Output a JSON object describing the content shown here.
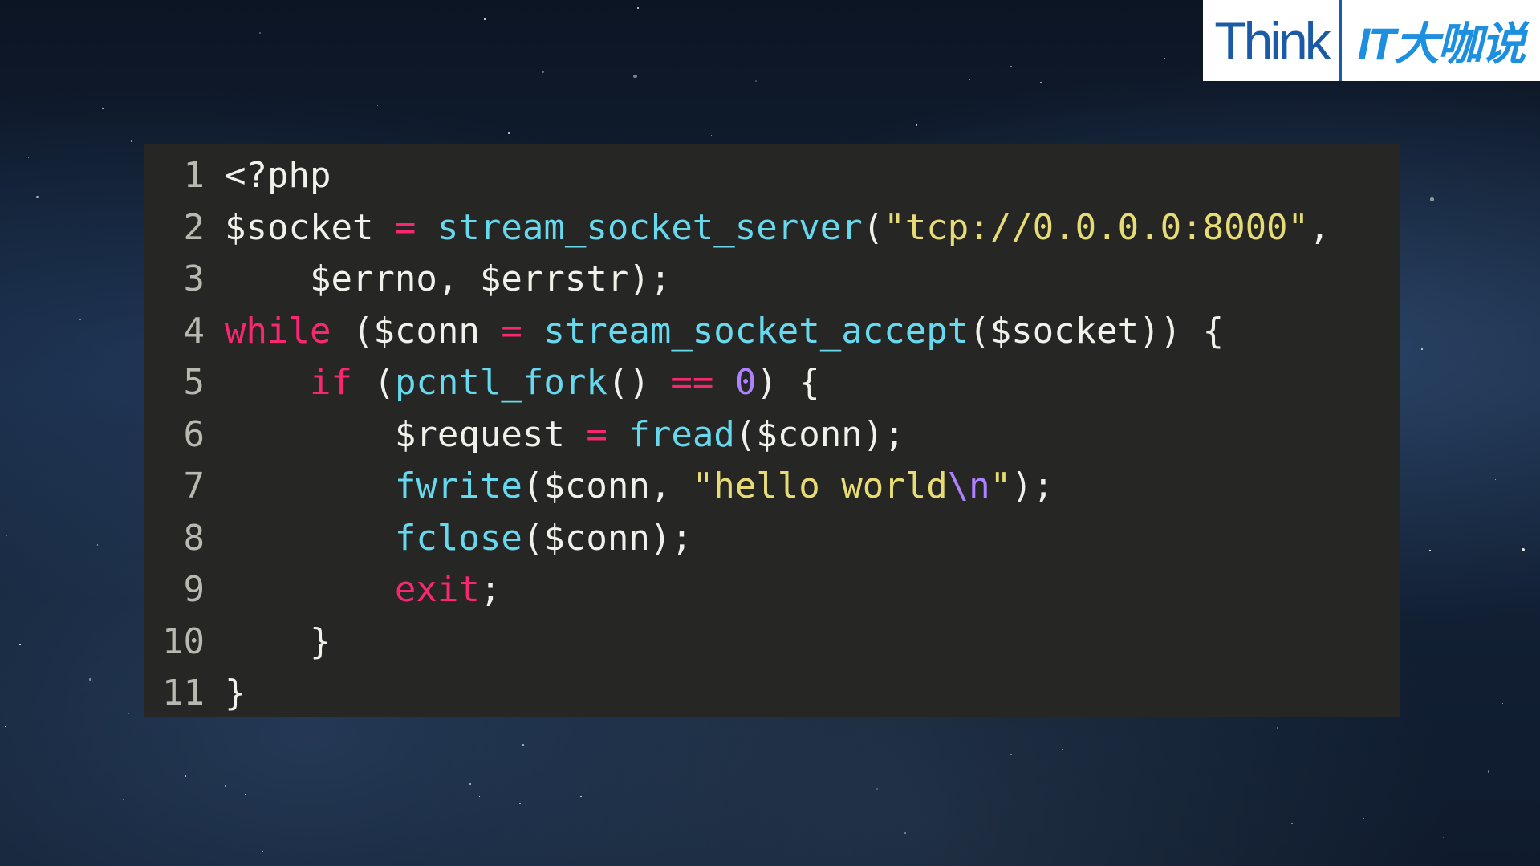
{
  "logo": {
    "think": "Think",
    "it": "IT大咖说"
  },
  "code": {
    "lines": [
      {
        "n": "1",
        "tokens": [
          {
            "t": "<?php",
            "c": "txt"
          }
        ]
      },
      {
        "n": "2",
        "tokens": [
          {
            "t": "$socket ",
            "c": "txt"
          },
          {
            "t": "=",
            "c": "op"
          },
          {
            "t": " ",
            "c": "txt"
          },
          {
            "t": "stream_socket_server",
            "c": "fn"
          },
          {
            "t": "(",
            "c": "txt"
          },
          {
            "t": "\"tcp://0.0.0.0:8000\"",
            "c": "str"
          },
          {
            "t": ",",
            "c": "txt"
          }
        ]
      },
      {
        "n": "3",
        "tokens": [
          {
            "t": "    $errno, $errstr);",
            "c": "txt"
          }
        ]
      },
      {
        "n": "4",
        "tokens": [
          {
            "t": "while",
            "c": "kw"
          },
          {
            "t": " ($conn ",
            "c": "txt"
          },
          {
            "t": "=",
            "c": "op"
          },
          {
            "t": " ",
            "c": "txt"
          },
          {
            "t": "stream_socket_accept",
            "c": "fn"
          },
          {
            "t": "($socket)) {",
            "c": "txt"
          }
        ]
      },
      {
        "n": "5",
        "tokens": [
          {
            "t": "    ",
            "c": "txt"
          },
          {
            "t": "if",
            "c": "kw"
          },
          {
            "t": " (",
            "c": "txt"
          },
          {
            "t": "pcntl_fork",
            "c": "fn"
          },
          {
            "t": "() ",
            "c": "txt"
          },
          {
            "t": "==",
            "c": "op"
          },
          {
            "t": " ",
            "c": "txt"
          },
          {
            "t": "0",
            "c": "num"
          },
          {
            "t": ") {",
            "c": "txt"
          }
        ]
      },
      {
        "n": "6",
        "tokens": [
          {
            "t": "        $request ",
            "c": "txt"
          },
          {
            "t": "=",
            "c": "op"
          },
          {
            "t": " ",
            "c": "txt"
          },
          {
            "t": "fread",
            "c": "fn"
          },
          {
            "t": "($conn);",
            "c": "txt"
          }
        ]
      },
      {
        "n": "7",
        "tokens": [
          {
            "t": "        ",
            "c": "txt"
          },
          {
            "t": "fwrite",
            "c": "fn"
          },
          {
            "t": "($conn, ",
            "c": "txt"
          },
          {
            "t": "\"hello world",
            "c": "str"
          },
          {
            "t": "\\n",
            "c": "esc"
          },
          {
            "t": "\"",
            "c": "str"
          },
          {
            "t": ");",
            "c": "txt"
          }
        ]
      },
      {
        "n": "8",
        "tokens": [
          {
            "t": "        ",
            "c": "txt"
          },
          {
            "t": "fclose",
            "c": "fn"
          },
          {
            "t": "($conn);",
            "c": "txt"
          }
        ]
      },
      {
        "n": "9",
        "tokens": [
          {
            "t": "        ",
            "c": "txt"
          },
          {
            "t": "exit",
            "c": "kw"
          },
          {
            "t": ";",
            "c": "txt"
          }
        ]
      },
      {
        "n": "10",
        "tokens": [
          {
            "t": "    }",
            "c": "txt"
          }
        ]
      },
      {
        "n": "11",
        "tokens": [
          {
            "t": "}",
            "c": "txt"
          }
        ]
      }
    ]
  },
  "colors": {
    "background": "#0f1b2d",
    "code_bg": "#262624",
    "keyword": "#f92672",
    "function": "#66d9ef",
    "string": "#e6db74",
    "number": "#ae81ff",
    "text": "#f1f1ec",
    "line_number": "#b9b9b2",
    "logo_think": "#1a5aa6",
    "logo_it": "#1d8fe0"
  }
}
